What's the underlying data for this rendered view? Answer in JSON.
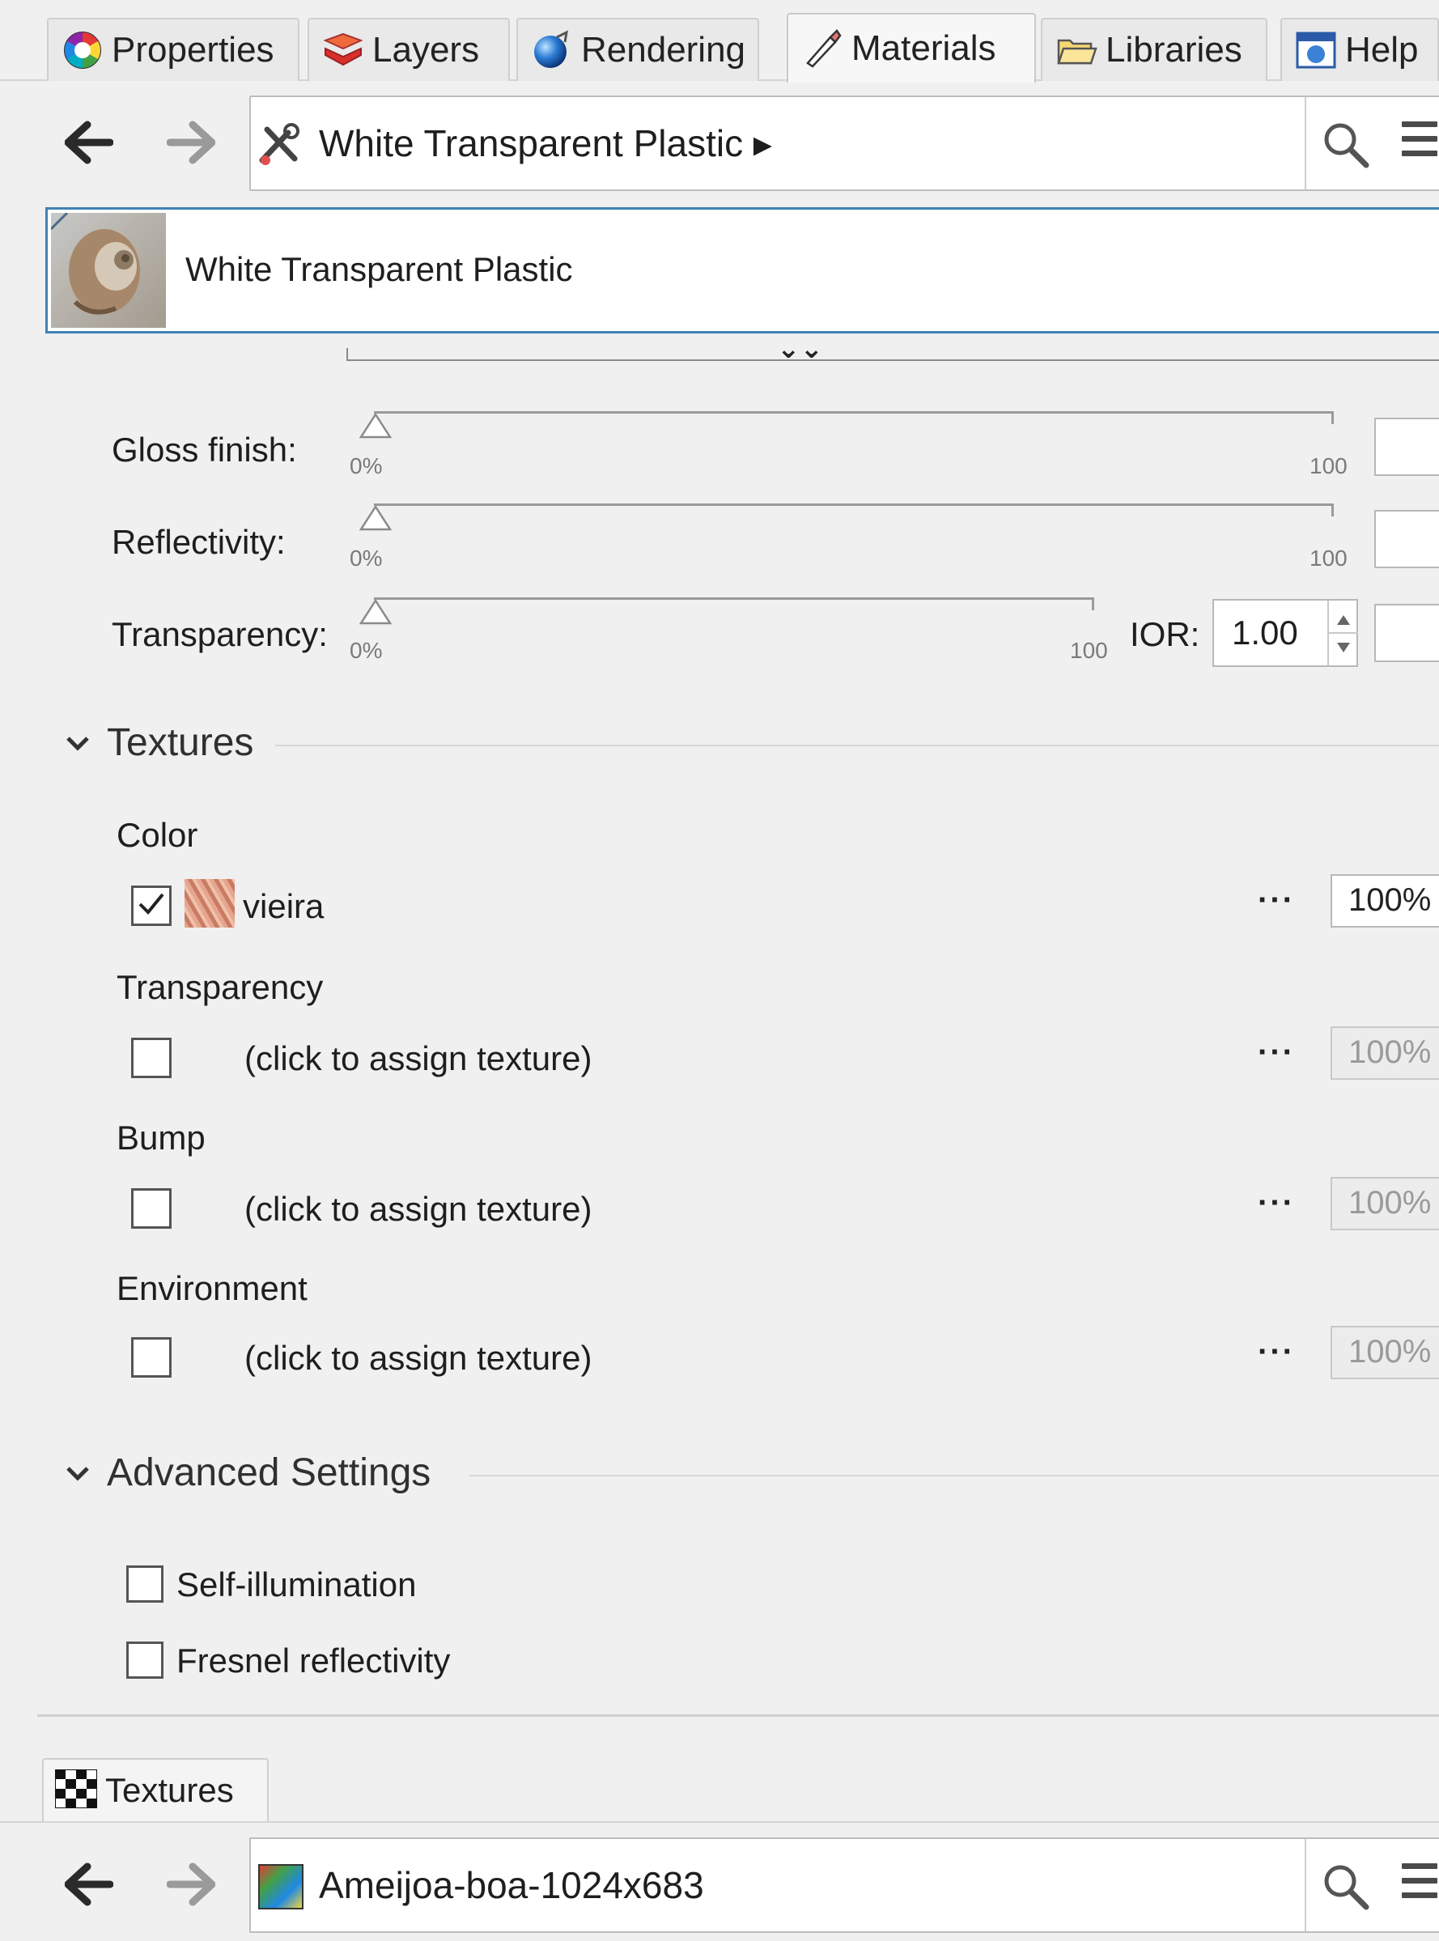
{
  "tabs": [
    {
      "label": "Properties",
      "icon": "properties-icon"
    },
    {
      "label": "Layers",
      "icon": "layers-icon"
    },
    {
      "label": "Rendering",
      "icon": "rendering-icon"
    },
    {
      "label": "Materials",
      "icon": "materials-icon"
    },
    {
      "label": "Libraries",
      "icon": "libraries-icon"
    },
    {
      "label": "Help",
      "icon": "help-icon"
    }
  ],
  "active_tab": "Materials",
  "material_nav": {
    "back_icon": "back-arrow-icon",
    "forward_icon": "forward-arrow-icon",
    "current": "White Transparent Plastic ▸",
    "current_icon": "material-tools-icon",
    "search_icon": "search-icon",
    "menu_icon": "hamburger-menu-icon"
  },
  "material_card": {
    "name": "White Transparent Plastic",
    "expand_glyph": "⌄⌄"
  },
  "sliders": [
    {
      "label": "Gloss finish:",
      "min_label": "0%",
      "max_label": "100",
      "value": 0
    },
    {
      "label": "Reflectivity:",
      "min_label": "0%",
      "max_label": "100",
      "value": 0
    },
    {
      "label": "Transparency:",
      "min_label": "0%",
      "max_label": "100",
      "value": 0
    }
  ],
  "ior": {
    "label": "IOR:",
    "value": "1.00"
  },
  "textures_section": {
    "title": "Textures",
    "rows": [
      {
        "heading": "Color",
        "checked": true,
        "texture": "vieira",
        "has_thumb": true,
        "amount": "100%",
        "enabled": true
      },
      {
        "heading": "Transparency",
        "checked": false,
        "texture": "(click to assign texture)",
        "has_thumb": false,
        "amount": "100%",
        "enabled": false
      },
      {
        "heading": "Bump",
        "checked": false,
        "texture": "(click to assign texture)",
        "has_thumb": false,
        "amount": "100%",
        "enabled": false
      },
      {
        "heading": "Environment",
        "checked": false,
        "texture": "(click to assign texture)",
        "has_thumb": false,
        "amount": "100%",
        "enabled": false
      }
    ],
    "more_glyph": "···"
  },
  "advanced_section": {
    "title": "Advanced Settings",
    "options": [
      {
        "label": "Self-illumination",
        "checked": false
      },
      {
        "label": "Fresnel reflectivity",
        "checked": false
      }
    ]
  },
  "bottom_panel": {
    "tab_label": "Textures",
    "tab_icon": "checkerboard-icon",
    "current": "Ameijoa-boa-1024x683",
    "current_icon": "texture-thumbnail-icon"
  }
}
